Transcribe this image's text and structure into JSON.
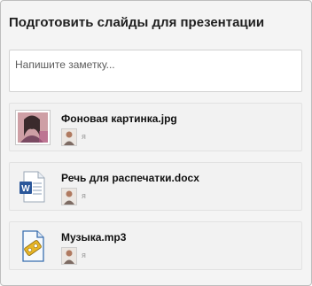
{
  "task": {
    "title": "Подготовить слайды для презентации"
  },
  "note": {
    "placeholder": "Напишите заметку..."
  },
  "attachments": [
    {
      "name": "Фоновая картинка.jpg",
      "owner": "я",
      "icon": "image-thumbnail-icon"
    },
    {
      "name": "Речь для распечатки.docx",
      "owner": "я",
      "icon": "word-document-icon"
    },
    {
      "name": "Музыка.mp3",
      "owner": "я",
      "icon": "audio-file-icon"
    }
  ],
  "colors": {
    "panel_bg": "#f4f4f4",
    "word_blue": "#2b579a",
    "audio_blue": "#3a6fb0",
    "audio_yellow": "#e7b526"
  }
}
